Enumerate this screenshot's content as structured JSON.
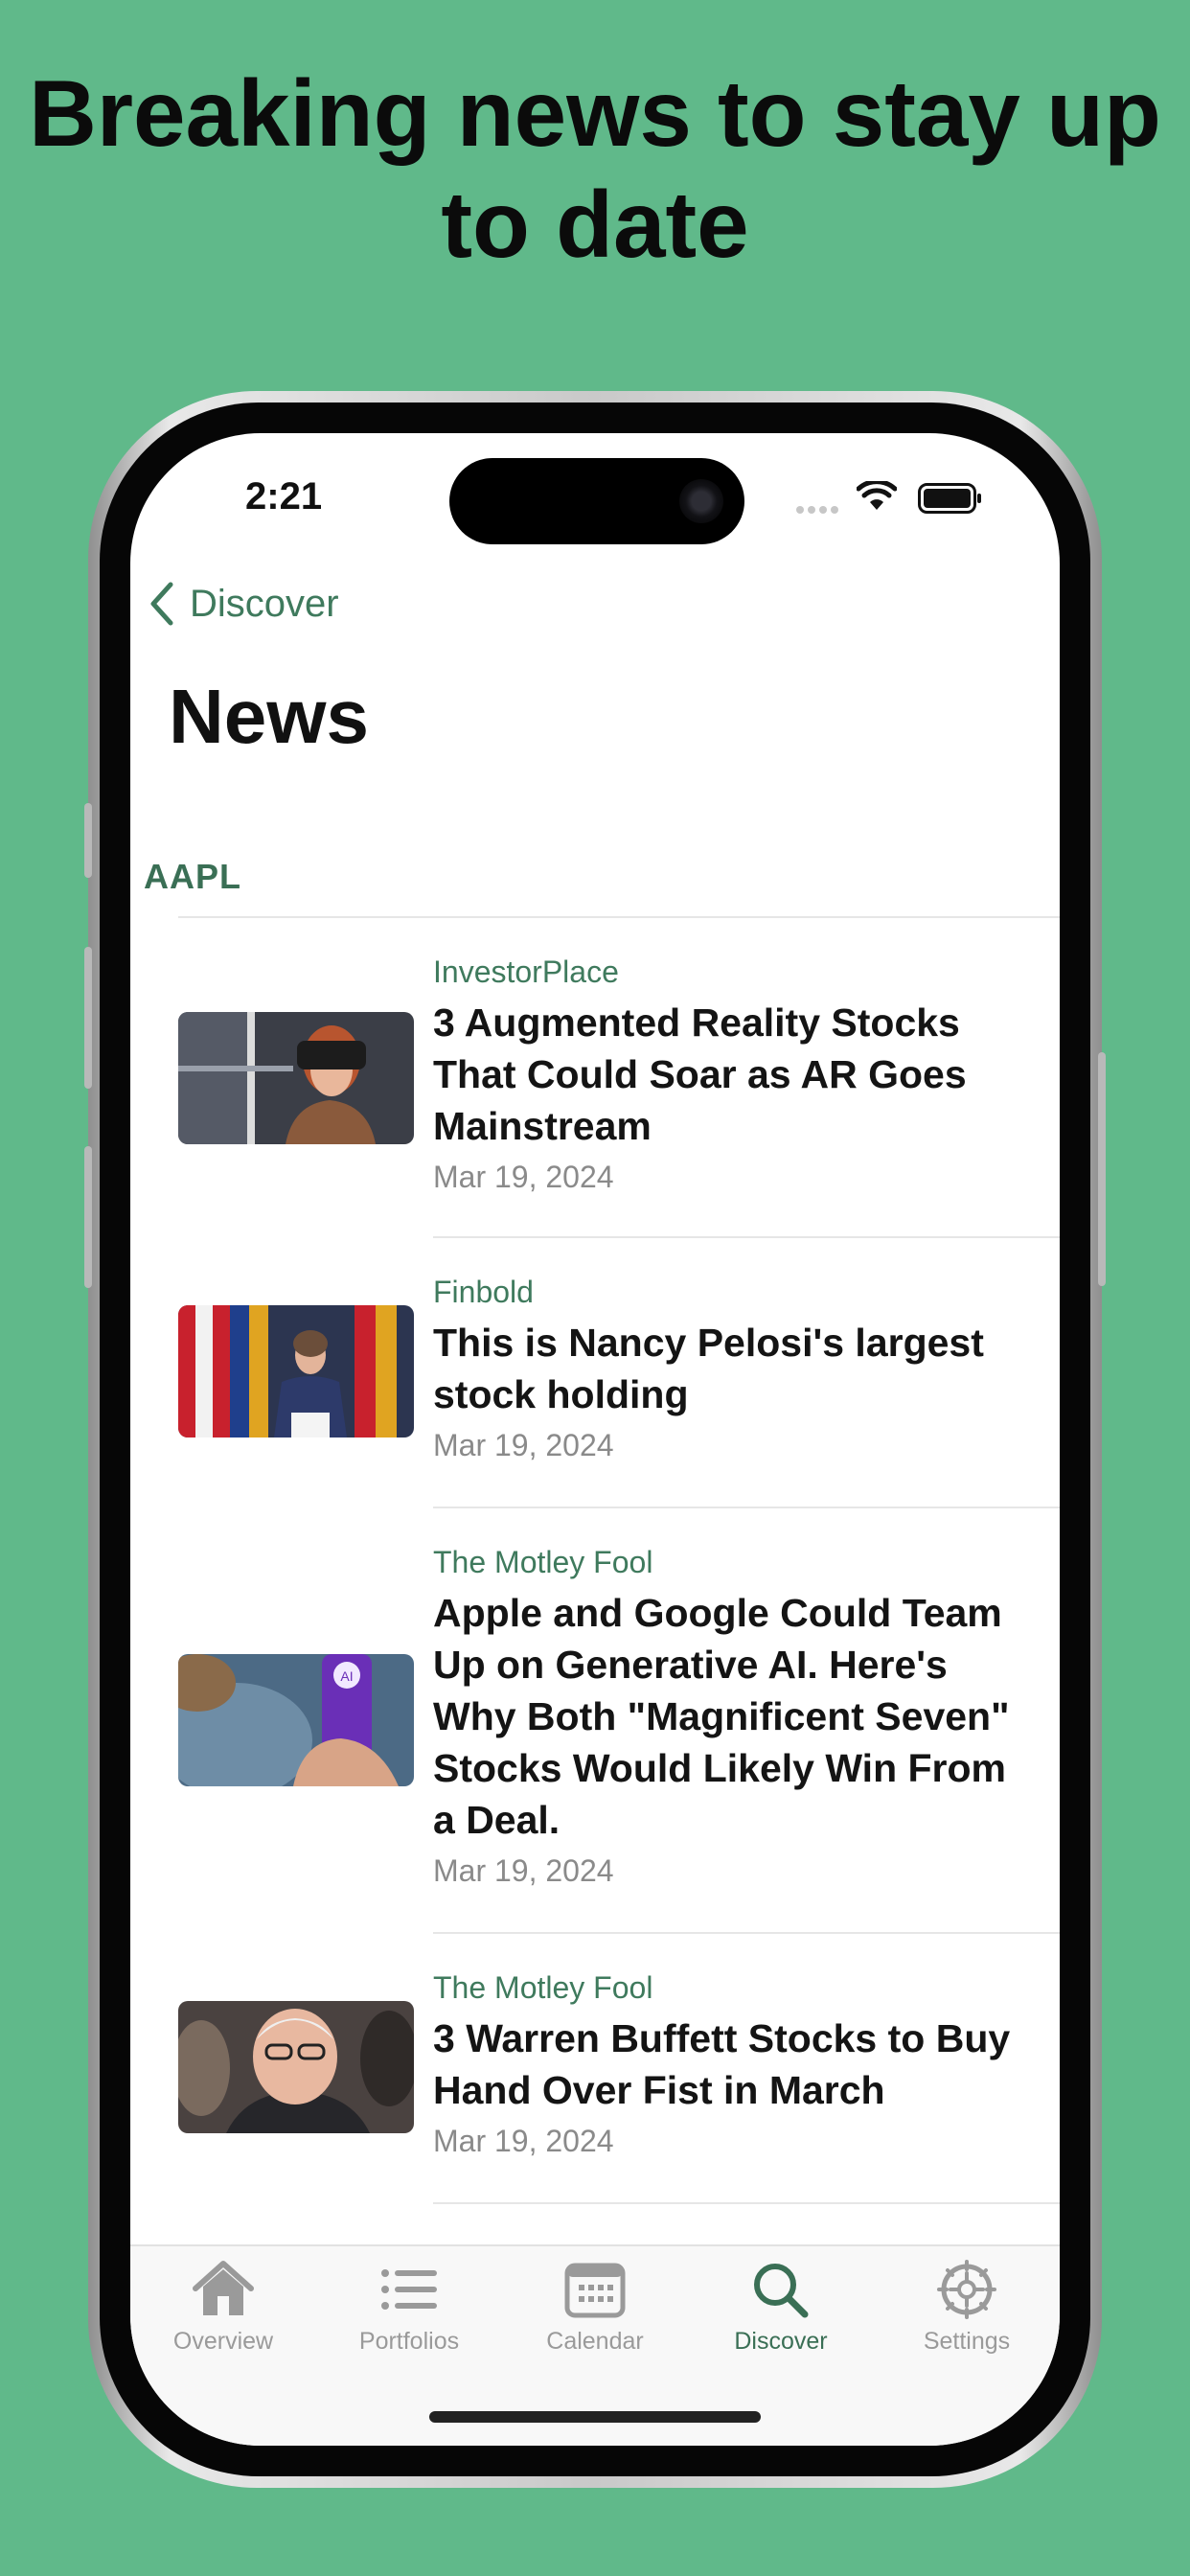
{
  "headline": "Breaking news to stay up to date",
  "status_bar": {
    "time": "2:21"
  },
  "nav": {
    "back_label": "Discover",
    "title": "News"
  },
  "section": {
    "ticker": "AAPL"
  },
  "news": [
    {
      "source": "InvestorPlace",
      "title": "3 Augmented Reality Stocks That Could Soar as AR Goes Mainstream",
      "date": "Mar 19, 2024"
    },
    {
      "source": "Finbold",
      "title": "This is Nancy Pelosi's largest stock holding",
      "date": "Mar 19, 2024"
    },
    {
      "source": "The Motley Fool",
      "title": "Apple and Google Could Team Up on Generative AI. Here's Why Both \"Magnificent Seven\" Stocks Would Likely Win From a Deal.",
      "date": "Mar 19, 2024"
    },
    {
      "source": "The Motley Fool",
      "title": "3 Warren Buffett Stocks to Buy Hand Over Fist in March",
      "date": "Mar 19, 2024"
    }
  ],
  "tabbar": {
    "tabs": [
      {
        "label": "Overview",
        "icon": "house-icon"
      },
      {
        "label": "Portfolios",
        "icon": "list-icon"
      },
      {
        "label": "Calendar",
        "icon": "calendar-icon"
      },
      {
        "label": "Discover",
        "icon": "search-icon",
        "active": true
      },
      {
        "label": "Settings",
        "icon": "gear-icon"
      }
    ]
  },
  "colors": {
    "background": "#60b98a",
    "accent": "#3f7a5d"
  }
}
